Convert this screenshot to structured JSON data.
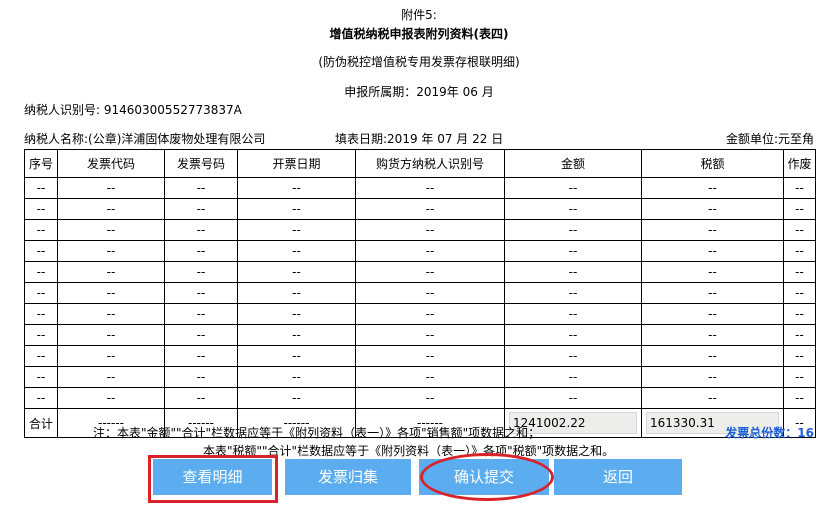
{
  "header": {
    "attachment": "附件5:",
    "title": "增值税纳税申报表附列资料(表四)",
    "subtitle": "(防伪税控增值税专用发票存根联明细)",
    "period": "申报所属期：2019年 06 月"
  },
  "taxpayer": {
    "id_line": "纳税人识别号: 91460300552773837A",
    "name_line": "纳税人名称:(公章)洋浦固体废物处理有限公司",
    "fill_date": "填表日期:2019 年 07 月 22 日",
    "unit": "金额单位:元至角"
  },
  "table": {
    "columns": [
      "序号",
      "发票代码",
      "发票号码",
      "开票日期",
      "购货方纳税人识别号",
      "金额",
      "税额",
      "作废"
    ],
    "rows": [
      [
        "--",
        "--",
        "--",
        "--",
        "--",
        "--",
        "--",
        "--"
      ],
      [
        "--",
        "--",
        "--",
        "--",
        "--",
        "--",
        "--",
        "--"
      ],
      [
        "--",
        "--",
        "--",
        "--",
        "--",
        "--",
        "--",
        "--"
      ],
      [
        "--",
        "--",
        "--",
        "--",
        "--",
        "--",
        "--",
        "--"
      ],
      [
        "--",
        "--",
        "--",
        "--",
        "--",
        "--",
        "--",
        "--"
      ],
      [
        "--",
        "--",
        "--",
        "--",
        "--",
        "--",
        "--",
        "--"
      ],
      [
        "--",
        "--",
        "--",
        "--",
        "--",
        "--",
        "--",
        "--"
      ],
      [
        "--",
        "--",
        "--",
        "--",
        "--",
        "--",
        "--",
        "--"
      ],
      [
        "--",
        "--",
        "--",
        "--",
        "--",
        "--",
        "--",
        "--"
      ],
      [
        "--",
        "--",
        "--",
        "--",
        "--",
        "--",
        "--",
        "--"
      ],
      [
        "--",
        "--",
        "--",
        "--",
        "--",
        "--",
        "--",
        "--"
      ]
    ],
    "total": {
      "label": "合计",
      "code": "------",
      "number": "------",
      "date": "------",
      "buyer": "------",
      "amount": "1241002.22",
      "tax": "161330.31",
      "void": "--"
    }
  },
  "notes": {
    "line1": "注：本表\"金额\"\"合计\"栏数据应等于《附列资料（表一）》各项\"销售额\"项数据之和；",
    "line2": "本表\"税额\"\"合计\"栏数据应等于《附列资料（表一）》各项\"税额\"项数据之和。",
    "count_label": "发票总份数：16"
  },
  "buttons": {
    "view_detail": "查看明细",
    "invoice_collect": "发票归集",
    "confirm_submit": "确认提交",
    "back": "返回"
  },
  "colors": {
    "button_bg": "#5cadef",
    "highlight": "#d9232b",
    "count_text": "#1b5fd6"
  }
}
